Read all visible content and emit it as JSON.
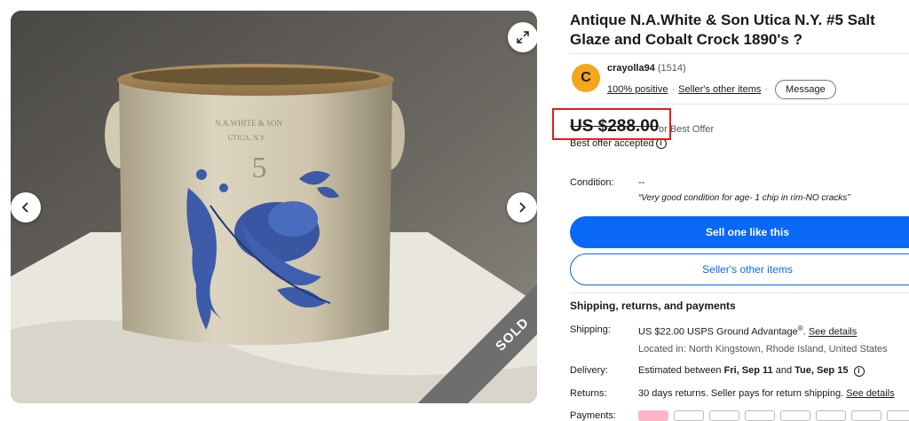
{
  "listing": {
    "title": "Antique N.A.White & Son Utica N.Y. #5 Salt Glaze and Cobalt Crock 1890's ?"
  },
  "gallery": {
    "sold_banner": "SOLD",
    "prev_icon": "chevron-left-icon",
    "next_icon": "chevron-right-icon",
    "expand_icon": "expand-icon",
    "crock_stamp_line1": "N.A.WHITE & SON",
    "crock_stamp_line2": "UTICA, N.Y.",
    "crock_number": "5"
  },
  "seller": {
    "avatar_letter": "C",
    "name": "crayolla94",
    "feedback_count": "(1514)",
    "positive": "100% positive",
    "sep": "·",
    "other_items": "Seller's other items",
    "message_label": "Message"
  },
  "price": {
    "amount": "US $288.00",
    "suffix": "or Best Offer",
    "offer_status": "Best offer accepted",
    "info_icon": "info-icon"
  },
  "condition": {
    "label": "Condition:",
    "value": "--",
    "note": "“Very good condition for age- 1 chip in rim-NO cracks”"
  },
  "actions": {
    "sell_one": "Sell one like this",
    "seller_other_items": "Seller's other items"
  },
  "shipping_section": {
    "title": "Shipping, returns, and payments",
    "shipping_label": "Shipping:",
    "shipping_value": "US $22.00 USPS Ground Advantage",
    "shipping_sup": "®",
    "shipping_sep": ". ",
    "see_details": "See details",
    "location": "Located in: North Kingstown, Rhode Island, United States",
    "delivery_label": "Delivery:",
    "delivery_prefix": "Estimated between ",
    "delivery_start": "Fri, Sep 11",
    "delivery_and": " and ",
    "delivery_end": "Tue, Sep 15",
    "returns_label": "Returns:",
    "returns_value": "30 days returns. Seller pays for return shipping. ",
    "returns_see_details": "See details",
    "payments_label": "Payments:"
  },
  "colors": {
    "accent_blue": "#0968f6",
    "highlight_red": "#e0201b",
    "avatar_orange": "#f4a61d"
  }
}
